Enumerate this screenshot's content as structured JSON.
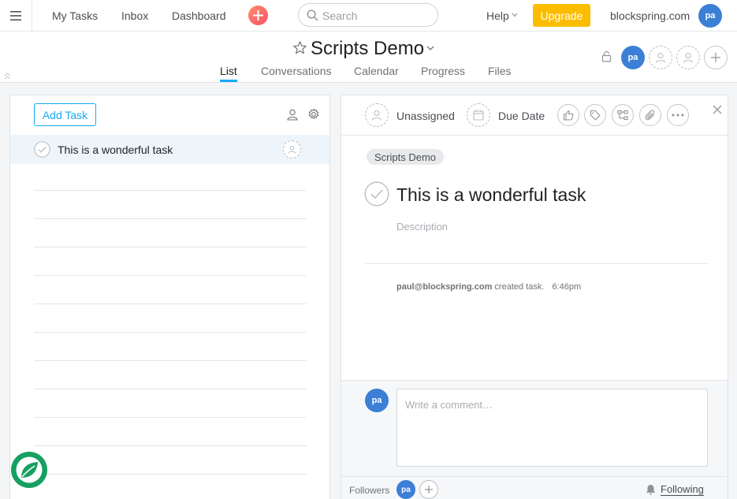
{
  "topbar": {
    "nav": [
      "My Tasks",
      "Inbox",
      "Dashboard"
    ],
    "search_placeholder": "Search",
    "help_label": "Help",
    "upgrade_label": "Upgrade",
    "workspace_name": "blockspring.com",
    "user_initials": "pa"
  },
  "project": {
    "title": "Scripts Demo",
    "tabs": [
      "List",
      "Conversations",
      "Calendar",
      "Progress",
      "Files"
    ],
    "active_tab": "List",
    "member_initials": "pa"
  },
  "list_panel": {
    "add_task_label": "Add Task",
    "tasks": [
      {
        "name": "This is a wonderful task",
        "selected": true
      }
    ]
  },
  "task_detail": {
    "assignee_label": "Unassigned",
    "due_date_label": "Due Date",
    "project_tag": "Scripts Demo",
    "task_title": "This is a wonderful task",
    "description_placeholder": "Description",
    "activity": {
      "user": "paul@blockspring.com",
      "action": "created task.",
      "time": "6:46pm"
    },
    "comment_placeholder": "Write a comment…",
    "commenter_initials": "pa",
    "followers_label": "Followers",
    "follower_initials": "pa",
    "following_label": "Following"
  },
  "colors": {
    "accent_blue": "#3b7fd6",
    "upgrade_yellow": "#fcbd01",
    "active_tab_underline": "#14aaf5",
    "logo_green": "#16a061"
  }
}
